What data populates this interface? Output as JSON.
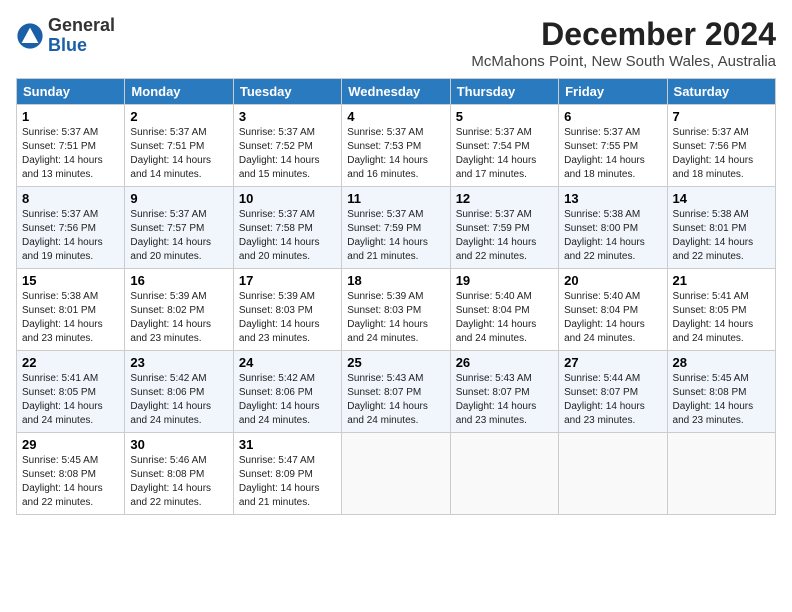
{
  "header": {
    "logo_general": "General",
    "logo_blue": "Blue",
    "title": "December 2024",
    "subtitle": "McMahons Point, New South Wales, Australia"
  },
  "calendar": {
    "days_of_week": [
      "Sunday",
      "Monday",
      "Tuesday",
      "Wednesday",
      "Thursday",
      "Friday",
      "Saturday"
    ],
    "weeks": [
      [
        {
          "day": "",
          "info": ""
        },
        {
          "day": "2",
          "info": "Sunrise: 5:37 AM\nSunset: 7:51 PM\nDaylight: 14 hours\nand 14 minutes."
        },
        {
          "day": "3",
          "info": "Sunrise: 5:37 AM\nSunset: 7:52 PM\nDaylight: 14 hours\nand 15 minutes."
        },
        {
          "day": "4",
          "info": "Sunrise: 5:37 AM\nSunset: 7:53 PM\nDaylight: 14 hours\nand 16 minutes."
        },
        {
          "day": "5",
          "info": "Sunrise: 5:37 AM\nSunset: 7:54 PM\nDaylight: 14 hours\nand 17 minutes."
        },
        {
          "day": "6",
          "info": "Sunrise: 5:37 AM\nSunset: 7:55 PM\nDaylight: 14 hours\nand 18 minutes."
        },
        {
          "day": "7",
          "info": "Sunrise: 5:37 AM\nSunset: 7:56 PM\nDaylight: 14 hours\nand 18 minutes."
        }
      ],
      [
        {
          "day": "1",
          "info": "Sunrise: 5:37 AM\nSunset: 7:51 PM\nDaylight: 14 hours\nand 13 minutes."
        },
        {
          "day": "",
          "info": ""
        },
        {
          "day": "",
          "info": ""
        },
        {
          "day": "",
          "info": ""
        },
        {
          "day": "",
          "info": ""
        },
        {
          "day": "",
          "info": ""
        },
        {
          "day": "",
          "info": ""
        }
      ],
      [
        {
          "day": "8",
          "info": "Sunrise: 5:37 AM\nSunset: 7:56 PM\nDaylight: 14 hours\nand 19 minutes."
        },
        {
          "day": "9",
          "info": "Sunrise: 5:37 AM\nSunset: 7:57 PM\nDaylight: 14 hours\nand 20 minutes."
        },
        {
          "day": "10",
          "info": "Sunrise: 5:37 AM\nSunset: 7:58 PM\nDaylight: 14 hours\nand 20 minutes."
        },
        {
          "day": "11",
          "info": "Sunrise: 5:37 AM\nSunset: 7:59 PM\nDaylight: 14 hours\nand 21 minutes."
        },
        {
          "day": "12",
          "info": "Sunrise: 5:37 AM\nSunset: 7:59 PM\nDaylight: 14 hours\nand 22 minutes."
        },
        {
          "day": "13",
          "info": "Sunrise: 5:38 AM\nSunset: 8:00 PM\nDaylight: 14 hours\nand 22 minutes."
        },
        {
          "day": "14",
          "info": "Sunrise: 5:38 AM\nSunset: 8:01 PM\nDaylight: 14 hours\nand 22 minutes."
        }
      ],
      [
        {
          "day": "15",
          "info": "Sunrise: 5:38 AM\nSunset: 8:01 PM\nDaylight: 14 hours\nand 23 minutes."
        },
        {
          "day": "16",
          "info": "Sunrise: 5:39 AM\nSunset: 8:02 PM\nDaylight: 14 hours\nand 23 minutes."
        },
        {
          "day": "17",
          "info": "Sunrise: 5:39 AM\nSunset: 8:03 PM\nDaylight: 14 hours\nand 23 minutes."
        },
        {
          "day": "18",
          "info": "Sunrise: 5:39 AM\nSunset: 8:03 PM\nDaylight: 14 hours\nand 24 minutes."
        },
        {
          "day": "19",
          "info": "Sunrise: 5:40 AM\nSunset: 8:04 PM\nDaylight: 14 hours\nand 24 minutes."
        },
        {
          "day": "20",
          "info": "Sunrise: 5:40 AM\nSunset: 8:04 PM\nDaylight: 14 hours\nand 24 minutes."
        },
        {
          "day": "21",
          "info": "Sunrise: 5:41 AM\nSunset: 8:05 PM\nDaylight: 14 hours\nand 24 minutes."
        }
      ],
      [
        {
          "day": "22",
          "info": "Sunrise: 5:41 AM\nSunset: 8:05 PM\nDaylight: 14 hours\nand 24 minutes."
        },
        {
          "day": "23",
          "info": "Sunrise: 5:42 AM\nSunset: 8:06 PM\nDaylight: 14 hours\nand 24 minutes."
        },
        {
          "day": "24",
          "info": "Sunrise: 5:42 AM\nSunset: 8:06 PM\nDaylight: 14 hours\nand 24 minutes."
        },
        {
          "day": "25",
          "info": "Sunrise: 5:43 AM\nSunset: 8:07 PM\nDaylight: 14 hours\nand 24 minutes."
        },
        {
          "day": "26",
          "info": "Sunrise: 5:43 AM\nSunset: 8:07 PM\nDaylight: 14 hours\nand 23 minutes."
        },
        {
          "day": "27",
          "info": "Sunrise: 5:44 AM\nSunset: 8:07 PM\nDaylight: 14 hours\nand 23 minutes."
        },
        {
          "day": "28",
          "info": "Sunrise: 5:45 AM\nSunset: 8:08 PM\nDaylight: 14 hours\nand 23 minutes."
        }
      ],
      [
        {
          "day": "29",
          "info": "Sunrise: 5:45 AM\nSunset: 8:08 PM\nDaylight: 14 hours\nand 22 minutes."
        },
        {
          "day": "30",
          "info": "Sunrise: 5:46 AM\nSunset: 8:08 PM\nDaylight: 14 hours\nand 22 minutes."
        },
        {
          "day": "31",
          "info": "Sunrise: 5:47 AM\nSunset: 8:09 PM\nDaylight: 14 hours\nand 21 minutes."
        },
        {
          "day": "",
          "info": ""
        },
        {
          "day": "",
          "info": ""
        },
        {
          "day": "",
          "info": ""
        },
        {
          "day": "",
          "info": ""
        }
      ]
    ]
  }
}
